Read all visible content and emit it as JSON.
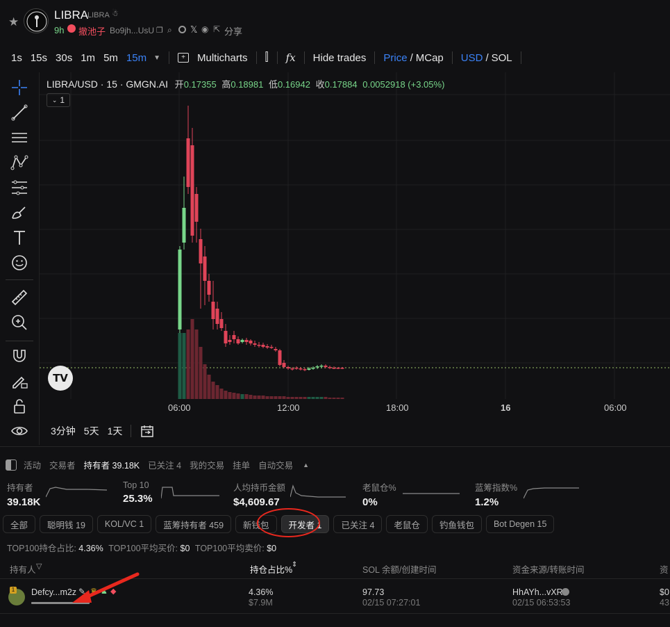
{
  "token": {
    "name": "LIBRA",
    "ticker": "LIBRA",
    "age": "9h",
    "rug_label": "撤池子",
    "address": "Bo9jh...UsU",
    "share": "分享"
  },
  "toolbar": {
    "timeframes": [
      "1s",
      "15s",
      "30s",
      "1m",
      "5m",
      "15m"
    ],
    "active_timeframe": "15m",
    "multicharts": "Multicharts",
    "hide_trades": "Hide trades",
    "price": "Price",
    "mcap": "MCap",
    "usd": "USD",
    "sol": "SOL",
    "fx": "fx"
  },
  "legend": {
    "symbol": "LIBRA/USD · 15 · GMGN.AI",
    "open_label": "开",
    "open": "0.17355",
    "high_label": "高",
    "high": "0.18981",
    "low_label": "低",
    "low": "0.16942",
    "close_label": "收",
    "close": "0.17884",
    "change": "0.0052918 (+3.05%)",
    "indicator_toggle": "1"
  },
  "colors": {
    "up": "#78d68a",
    "down": "#e04458",
    "accent": "#3b82f6",
    "rug": "#f24e5e"
  },
  "chart_data": {
    "type": "candlestick",
    "x_ticks": [
      "06:00",
      "12:00",
      "18:00",
      "16",
      "06:00"
    ],
    "last_price": 0.17884
  },
  "ranges": [
    "3分钟",
    "5天",
    "1天"
  ],
  "panel": {
    "tabs": [
      "活动",
      "交易者",
      "持有者 39.18K",
      "已关注 4",
      "我的交易",
      "挂单",
      "自动交易"
    ],
    "active_tab": "持有者 39.18K",
    "stats": [
      {
        "label": "持有者",
        "value": "39.18K"
      },
      {
        "label": "Top 10",
        "value": "25.3%"
      },
      {
        "label": "人均持币金额",
        "value": "$4,609.67"
      },
      {
        "label": "老鼠仓%",
        "value": "0%"
      },
      {
        "label": "蓝筹指数%",
        "value": "1.2%"
      }
    ],
    "filters": [
      "全部",
      "聪明钱 19",
      "KOL/VC 1",
      "蓝筹持有者 459",
      "新钱包",
      "开发者 1",
      "已关注 4",
      "老鼠仓",
      "钓鱼钱包",
      "Bot Degen 15"
    ],
    "active_filter": "开发者 1",
    "summary": {
      "top100_pct_label": "TOP100持仓占比:",
      "top100_pct": "4.36%",
      "top100_buy_label": "TOP100平均买价:",
      "top100_buy": "$0",
      "top100_sell_label": "TOP100平均卖价:",
      "top100_sell": "$0"
    },
    "columns": [
      "持有人",
      "持仓占比%",
      "SOL 余额/创建时间",
      "资金来源/转账时间",
      "资"
    ],
    "rows": [
      {
        "rank": "1",
        "holder": "Defcy...m2z",
        "pct": "4.36%",
        "value": "$7.9M",
        "sol": "97.73",
        "created": "02/15 07:27:01",
        "source": "HhAYh...vXR",
        "transfer_time": "02/15 06:53:53",
        "extra_top": "$0",
        "extra_bottom": "43"
      }
    ]
  }
}
